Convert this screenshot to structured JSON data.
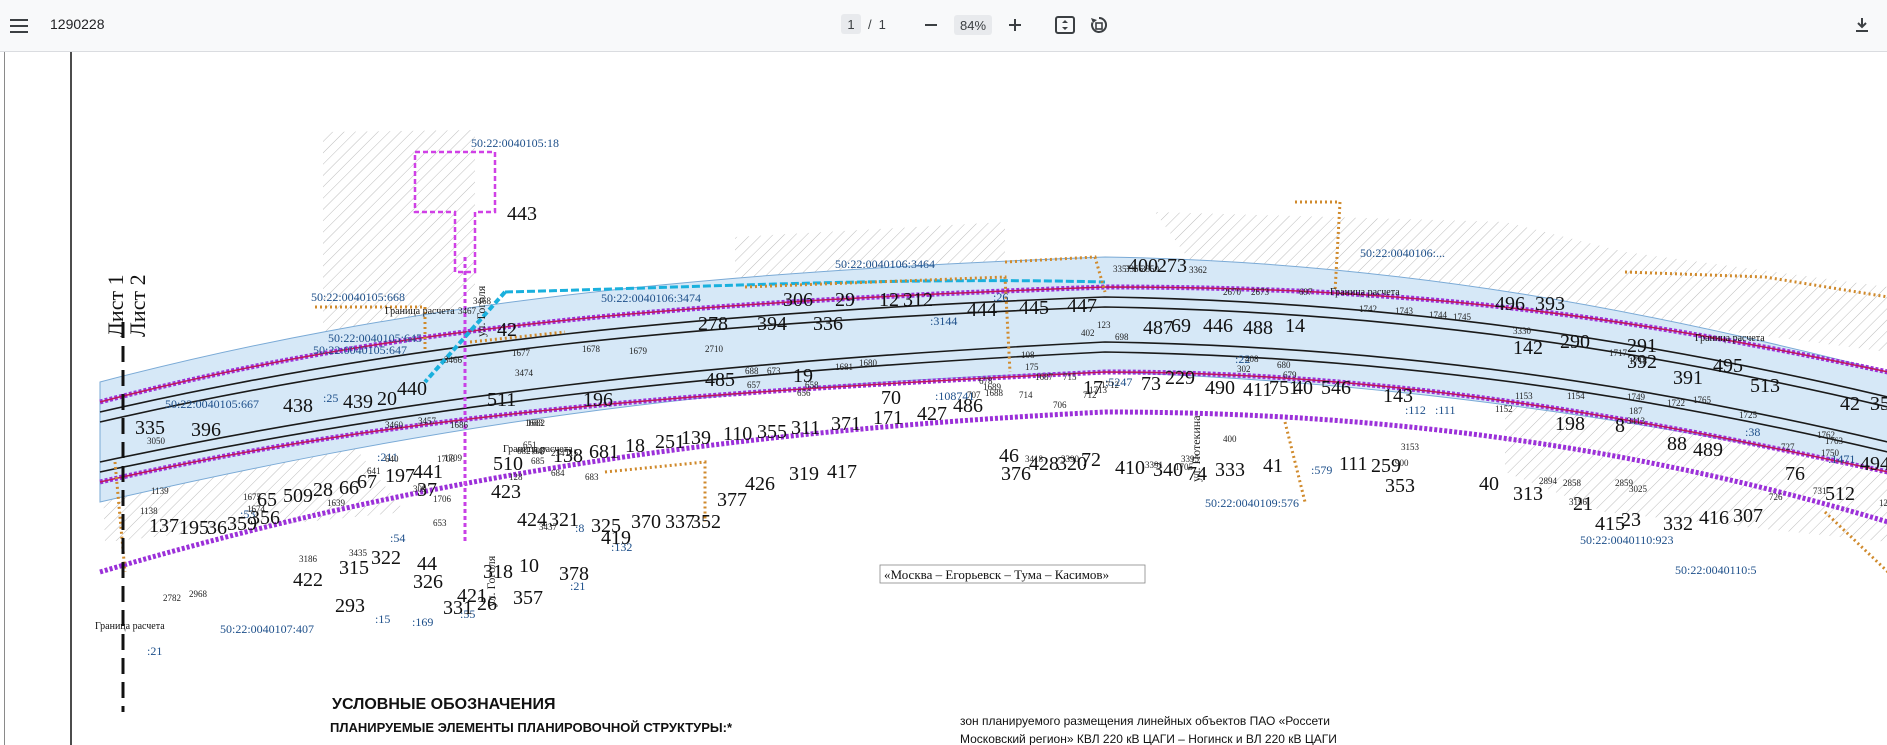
{
  "toolbar": {
    "title": "1290228",
    "page_current": "1",
    "page_sep": "/",
    "page_total": "1",
    "zoom": "84%",
    "icons": [
      "menu-icon",
      "zoom-out-icon",
      "zoom-in-icon",
      "fit-page-icon",
      "rotate-icon",
      "download-icon"
    ]
  },
  "map": {
    "sheet_labels": [
      "Лист 1",
      "Лист 2"
    ],
    "streets": [
      "ул. Гоголя",
      "ул. Гоголя",
      "ул. Потекина"
    ],
    "road_label": "«Москва – Егорьевск – Тума – Касимов»",
    "calc_boundary_label": "Граница расчета",
    "parcels": [
      "50:22:0040105:18",
      "50:22:0040106:3464",
      "50:22:0040105:668",
      "50:22:0040106:3474",
      "50:22:0040105:645",
      "50:22:0040105:647",
      "50:22:0040105:667",
      "50:22:0040107:407",
      "50:22:0040109:576",
      "50:22:0040110:923",
      "50:22:0040110:5",
      "50:22:0040106:..."
    ],
    "short_codes": [
      ":25",
      ":211",
      ":53",
      ":54",
      ":15",
      ":169",
      ":55",
      ":21",
      ":132",
      ":8",
      ":3144",
      ":26",
      ":5247",
      ":22",
      ":579",
      ":112",
      ":111",
      ":38",
      ":1471",
      ":108741",
      ":21"
    ],
    "big_numbers": [
      "443",
      "42",
      "511",
      "196",
      "278",
      "306",
      "29",
      "12",
      "312",
      "394",
      "336",
      "444",
      "445",
      "447",
      "400",
      "273",
      "487",
      "69",
      "446",
      "488",
      "14",
      "496",
      "393",
      "290",
      "142",
      "291",
      "392",
      "391",
      "495",
      "513",
      "42",
      "351",
      "335",
      "396",
      "438",
      "439",
      "20",
      "440",
      "485",
      "19",
      "70",
      "486",
      "427",
      "171",
      "371",
      "311",
      "355",
      "110",
      "139",
      "251",
      "18",
      "681",
      "138",
      "17",
      "73",
      "229",
      "490",
      "411",
      "751",
      "40",
      "546",
      "143",
      "198",
      "8",
      "88",
      "489",
      "76",
      "512",
      "494",
      "65",
      "509",
      "28",
      "66",
      "67",
      "197",
      "441",
      "37",
      "510",
      "423",
      "424",
      "321",
      "325",
      "370",
      "337",
      "352",
      "377",
      "426",
      "319",
      "417",
      "46",
      "376",
      "428",
      "320",
      "72",
      "410",
      "340",
      "74",
      "333",
      "41",
      "111",
      "259",
      "353",
      "40",
      "313",
      "21",
      "415",
      "23",
      "332",
      "416",
      "307",
      "137",
      "195",
      "36",
      "359",
      "356",
      "422",
      "315",
      "322",
      "44",
      "421",
      "326",
      "318",
      "10",
      "378",
      "419",
      "293",
      "331",
      "26",
      "357"
    ],
    "small_numbers": [
      "3468",
      "3467",
      "3466",
      "3474",
      "3460",
      "3457",
      "1677",
      "1678",
      "1679",
      "2710",
      "1683",
      "1682",
      "1686",
      "1708",
      "1709",
      "1706",
      "3050",
      "1139",
      "1138",
      "1675",
      "1674",
      "1639",
      "3186",
      "3435",
      "3437",
      "2968",
      "2782",
      "3356",
      "3350",
      "3357",
      "3362",
      "2670",
      "2673",
      "697",
      "1742",
      "1743",
      "1744",
      "1745",
      "3330",
      "1717",
      "1718",
      "1154",
      "1153",
      "1152",
      "1722",
      "1749",
      "1765",
      "1725",
      "1762",
      "1750",
      "1763",
      "727",
      "726",
      "731",
      "1241",
      "2894",
      "2858",
      "2859",
      "3025",
      "3156",
      "3153",
      "900",
      "187",
      "3413",
      "3418",
      "3390",
      "3391",
      "3395",
      "1705",
      "706",
      "707",
      "714",
      "715",
      "712",
      "1712",
      "1713",
      "680",
      "679",
      "678",
      "1689",
      "1688",
      "1687",
      "175",
      "108",
      "1681",
      "1680",
      "673",
      "688",
      "657",
      "658",
      "656",
      "651",
      "647",
      "685",
      "684",
      "683",
      "682",
      "703",
      "234",
      "115",
      "640",
      "641",
      "309",
      "653",
      "128",
      "123",
      "698",
      "402",
      "408",
      "302",
      "400"
    ]
  },
  "legend": {
    "title": "УСЛОВНЫЕ ОБОЗНАЧЕНИЯ",
    "subtitle": "ПЛАНИРУЕМЫЕ ЭЛЕМЕНТЫ ПЛАНИРОВОЧНОЙ СТРУКТУРЫ:*",
    "right_text_1": "зон планируемого размещения линейных объектов ПАО «Россети",
    "right_text_2": "Московский регион» КВЛ 220 кВ ЦАГИ – Ногинск и ВЛ 220 кВ ЦАГИ"
  }
}
